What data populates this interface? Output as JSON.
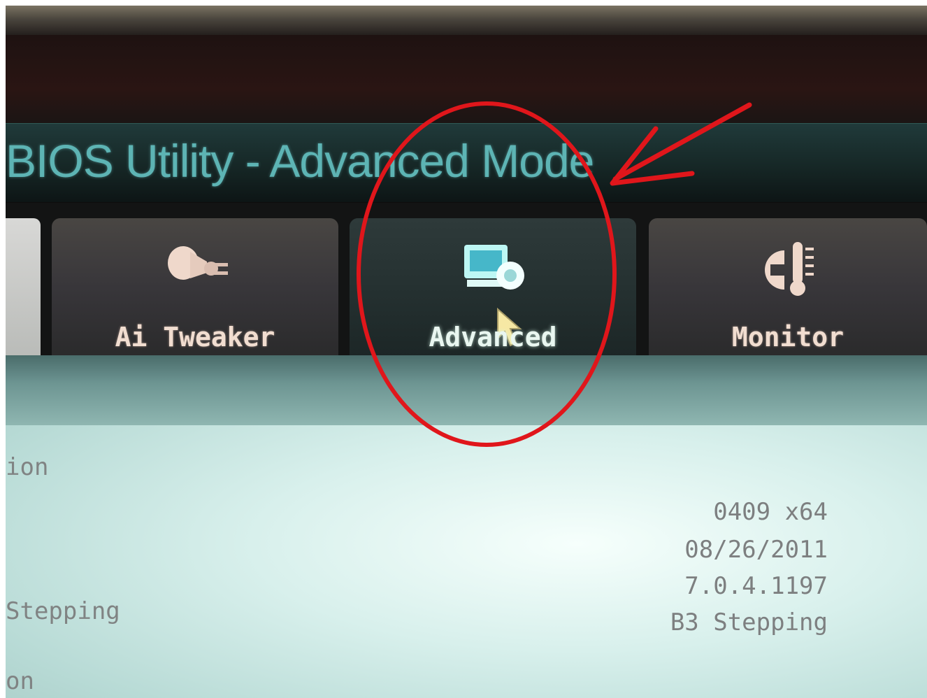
{
  "header": {
    "title": "BIOS Utility - Advanced Mode"
  },
  "tabs": [
    {
      "id": "ai_tweaker",
      "label": "Ai Tweaker",
      "icon": "ai-tweaker-icon",
      "selected": false
    },
    {
      "id": "advanced",
      "label": "Advanced",
      "icon": "advanced-icon",
      "selected": true
    },
    {
      "id": "monitor",
      "label": "Monitor",
      "icon": "monitor-icon",
      "selected": false
    }
  ],
  "info_panel": {
    "labels": [
      "ion",
      "Stepping",
      "on"
    ],
    "values": [
      "0409 x64",
      "08/26/2011",
      "7.0.4.1197",
      "B3 Stepping"
    ]
  },
  "colors": {
    "title_text": "#5db4b4",
    "tab_label": "#f1ddd0",
    "annotation_red": "#e0161b",
    "panel_bg": "#d8f0ec"
  }
}
